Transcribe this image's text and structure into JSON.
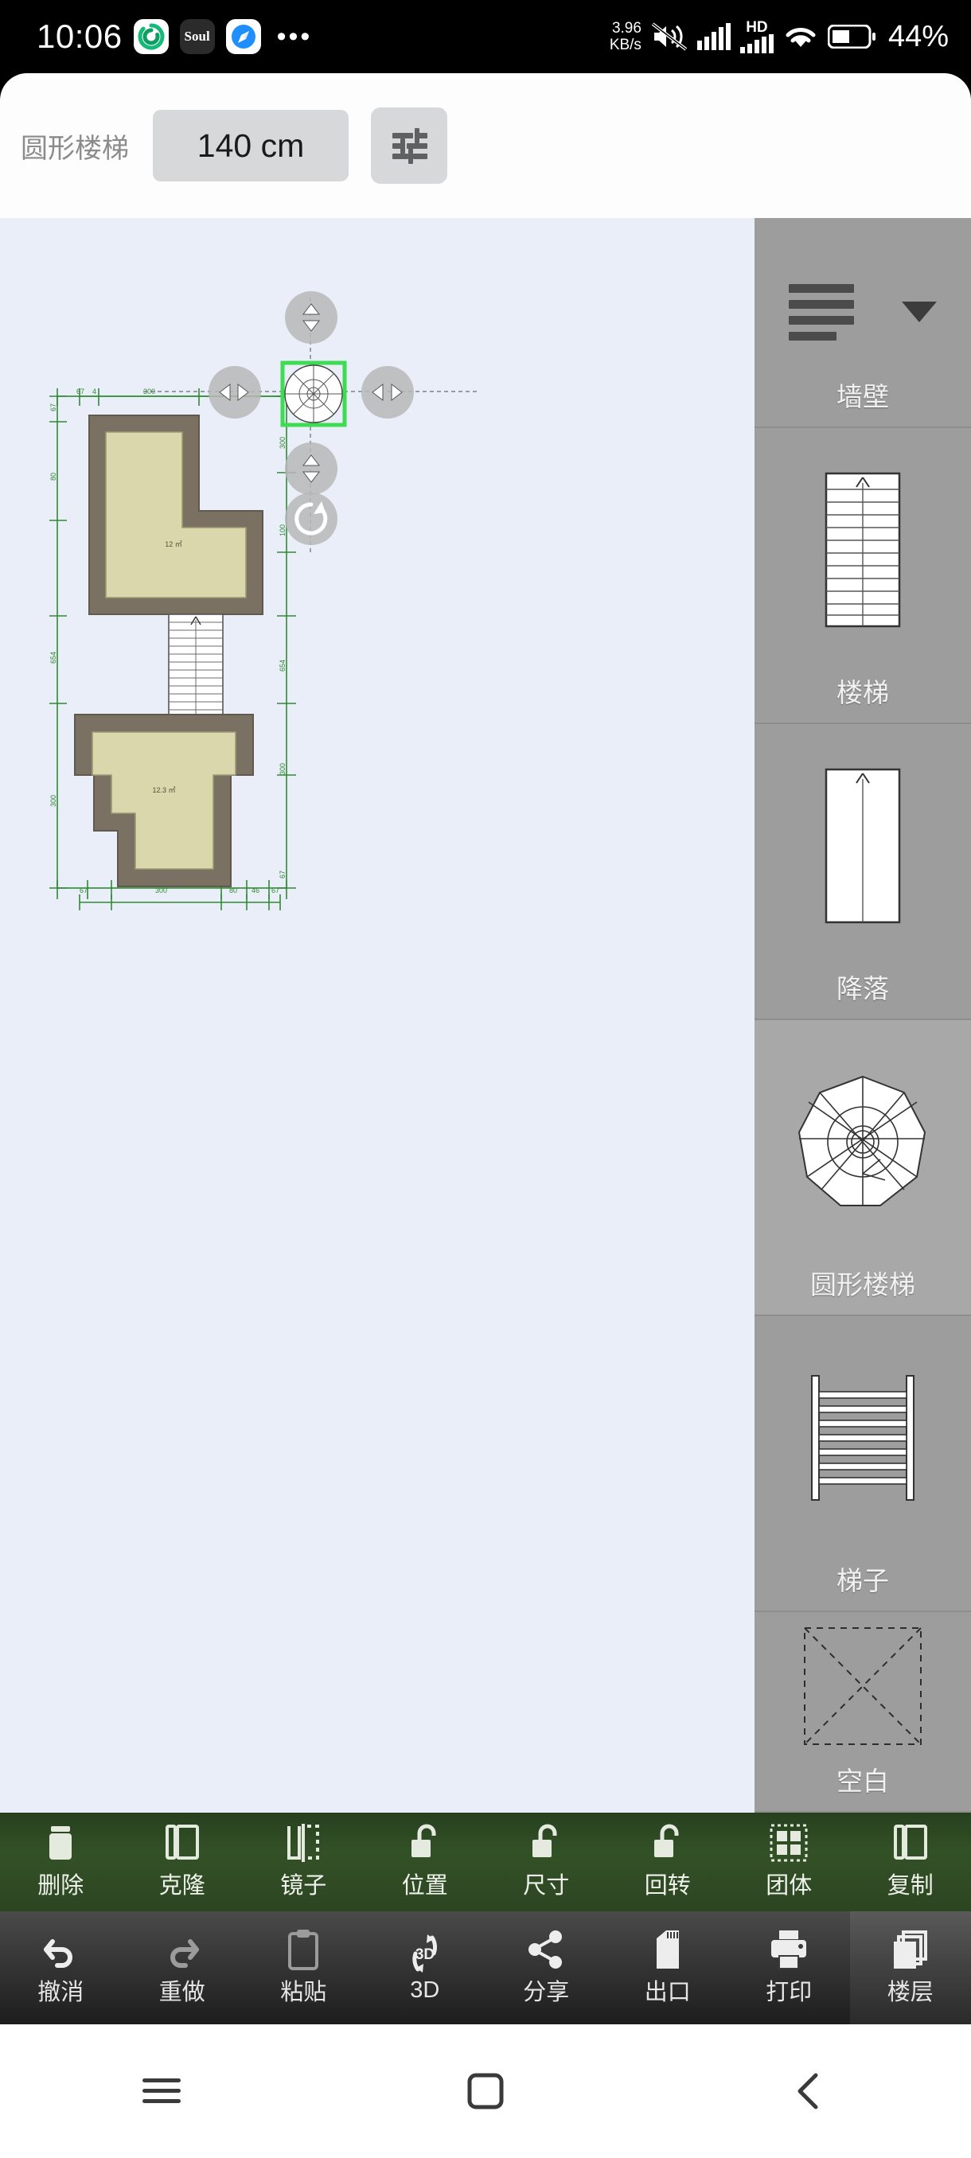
{
  "status_bar": {
    "time": "10:06",
    "app_icons": [
      "sync-green-icon",
      "soul-app-icon",
      "compass-blue-icon",
      "overflow-dots-icon"
    ],
    "soul_label": "Soul",
    "network_speed": "3.96",
    "network_speed_unit": "KB/s",
    "mute_icon": "mute-icon",
    "signal_icons": [
      "signal-bars-icon",
      "signal-bars-2-icon"
    ],
    "hd_label": "HD",
    "wifi_icon": "wifi-icon",
    "battery_icon": "battery-icon",
    "battery_percent": "44%"
  },
  "toolbar": {
    "object_label": "圆形楼梯",
    "dimension_value": "140 cm",
    "settings_icon": "sliders-icon"
  },
  "canvas": {
    "background_color": "#eaeef8",
    "selection_color": "#3ddc52",
    "wall_color": "#7a7163",
    "floor_color": "#d9d7ab",
    "dim_color": "#2e8b32",
    "rooms": [
      {
        "area_label": "12 ㎡"
      },
      {
        "area_label": "12.3 ㎡"
      }
    ],
    "dimensions_top": [
      "67",
      "4",
      "300"
    ],
    "dimensions_bottom": [
      "67",
      "300",
      "80",
      "46",
      "67"
    ],
    "dimensions_left": [
      "67",
      "80",
      "654",
      "300"
    ],
    "dimensions_right": [
      "300",
      "100",
      "654",
      "300",
      "67"
    ],
    "handles": {
      "move_up": "arrow-up-down-handle",
      "move_left": "arrow-left-right-handle",
      "move_right": "arrow-left-right-handle",
      "move_down": "arrow-up-down-handle",
      "rotate": "rotate-handle"
    },
    "selected_object": "spiral-staircase"
  },
  "palette": {
    "header_icon": "menu-lines-icon",
    "dropdown_icon": "chevron-down-icon",
    "items": [
      {
        "label": "墙壁",
        "icon": "wall-icon",
        "selected": false
      },
      {
        "label": "楼梯",
        "icon": "stairs-icon",
        "selected": false
      },
      {
        "label": "降落",
        "icon": "landing-icon",
        "selected": false
      },
      {
        "label": "圆形楼梯",
        "icon": "spiral-stairs-icon",
        "selected": true
      },
      {
        "label": "梯子",
        "icon": "ladder-icon",
        "selected": false
      },
      {
        "label": "空白",
        "icon": "blank-icon",
        "selected": false
      }
    ]
  },
  "green_toolbar": {
    "items": [
      {
        "label": "删除",
        "icon": "trash-icon"
      },
      {
        "label": "克隆",
        "icon": "clone-icon"
      },
      {
        "label": "镜子",
        "icon": "mirror-icon"
      },
      {
        "label": "位置",
        "icon": "unlock-position-icon"
      },
      {
        "label": "尺寸",
        "icon": "unlock-size-icon"
      },
      {
        "label": "回转",
        "icon": "unlock-rotate-icon"
      },
      {
        "label": "团体",
        "icon": "group-icon"
      },
      {
        "label": "复制",
        "icon": "copy-icon"
      }
    ]
  },
  "dark_toolbar": {
    "items": [
      {
        "label": "撤消",
        "icon": "undo-icon",
        "active": false
      },
      {
        "label": "重做",
        "icon": "redo-icon",
        "active": false
      },
      {
        "label": "粘贴",
        "icon": "paste-icon",
        "active": false
      },
      {
        "label": "3D",
        "icon": "3d-icon",
        "active": false
      },
      {
        "label": "分享",
        "icon": "share-icon",
        "active": false
      },
      {
        "label": "出口",
        "icon": "export-sdcard-icon",
        "active": false
      },
      {
        "label": "打印",
        "icon": "print-icon",
        "active": false
      },
      {
        "label": "楼层",
        "icon": "floors-icon",
        "active": true
      }
    ]
  },
  "nav_bar": {
    "items": [
      {
        "icon": "menu-icon"
      },
      {
        "icon": "home-square-icon"
      },
      {
        "icon": "back-chevron-icon"
      }
    ]
  }
}
